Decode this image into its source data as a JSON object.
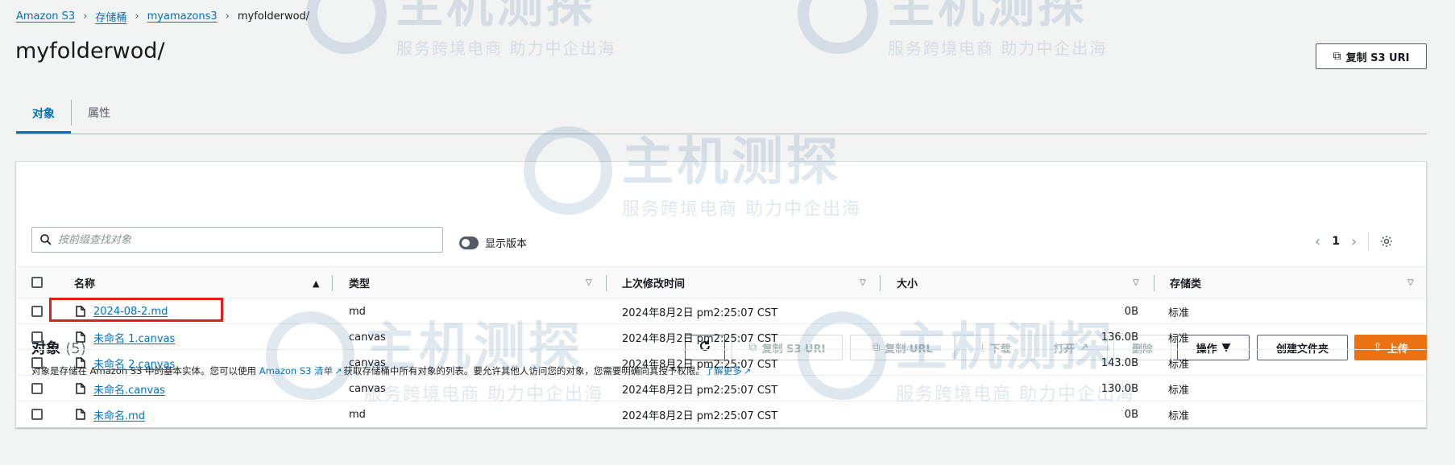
{
  "breadcrumb": {
    "items": [
      "Amazon S3",
      "存储桶",
      "myamazons3"
    ],
    "current": "myfolderwod/"
  },
  "page": {
    "title": "myfolderwod/",
    "copy_s3_uri_label": "复制 S3 URI"
  },
  "tabs": [
    {
      "label": "对象",
      "active": true
    },
    {
      "label": "属性",
      "active": false
    }
  ],
  "objects_panel": {
    "title": "对象",
    "count": "(5)",
    "description_prefix": "对象是存储在 Amazon S3 中的基本实体。您可以使用 ",
    "description_link": "Amazon S3 清单",
    "description_mid": "获取存储桶中所有对象的列表。要允许其他人访问您的对象，您需要明确向其授予权限。",
    "learn_more": "了解更多",
    "search_placeholder": "按前缀查找对象",
    "show_versions_label": "显示版本",
    "page_number": "1"
  },
  "toolbar": {
    "copy_s3_uri": "复制 S3 URI",
    "copy_url": "复制 URL",
    "download": "下载",
    "open": "打开",
    "delete": "删除",
    "actions": "操作",
    "create_folder": "创建文件夹",
    "upload": "上传"
  },
  "table": {
    "columns": [
      "名称",
      "类型",
      "上次修改时间",
      "大小",
      "存储类"
    ],
    "rows": [
      {
        "name": "2024-08-2.md",
        "type": "md",
        "modified": "2024年8月2日 pm2:25:07 CST",
        "size": "0B",
        "storage": "标准"
      },
      {
        "name": "未命名 1.canvas",
        "type": "canvas",
        "modified": "2024年8月2日 pm2:25:07 CST",
        "size": "136.0B",
        "storage": "标准"
      },
      {
        "name": "未命名 2.canvas",
        "type": "canvas",
        "modified": "2024年8月2日 pm2:25:07 CST",
        "size": "143.0B",
        "storage": "标准"
      },
      {
        "name": "未命名.canvas",
        "type": "canvas",
        "modified": "2024年8月2日 pm2:25:07 CST",
        "size": "130.0B",
        "storage": "标准"
      },
      {
        "name": "未命名.md",
        "type": "md",
        "modified": "2024年8月2日 pm2:25:07 CST",
        "size": "0B",
        "storage": "标准"
      }
    ]
  },
  "watermark": {
    "brand": "主机测探",
    "slogan": "服务跨境电商 助力中企出海"
  },
  "colors": {
    "link": "#0073bb",
    "primary": "#ec7211",
    "highlight": "#e01e1e",
    "background": "#f2f3f3"
  }
}
